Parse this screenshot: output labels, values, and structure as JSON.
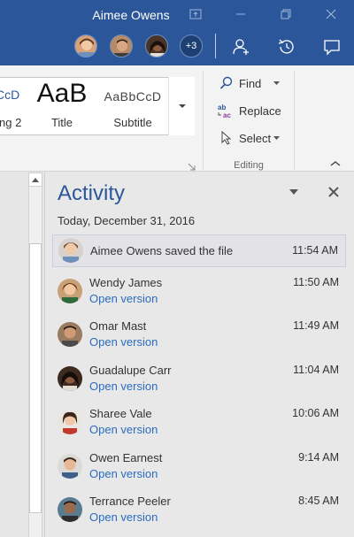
{
  "window": {
    "title": "Aimee Owens",
    "extra_collaborators": "+3"
  },
  "ribbon": {
    "styles": [
      {
        "sample": "CcD",
        "name": "ng 2"
      },
      {
        "sample": "AaB",
        "name": "Title"
      },
      {
        "sample": "AaBbCcD",
        "name": "Subtitle"
      }
    ],
    "editing": {
      "find_label": "Find",
      "replace_label": "Replace",
      "select_label": "Select",
      "group_label": "Editing"
    }
  },
  "activity": {
    "title": "Activity",
    "date": "Today, December 31, 2016",
    "items": [
      {
        "text": "Aimee Owens saved the file",
        "time": "11:54 AM",
        "link": ""
      },
      {
        "text": "Wendy James",
        "time": "11:50 AM",
        "link": "Open version"
      },
      {
        "text": "Omar Mast",
        "time": "11:49 AM",
        "link": "Open version"
      },
      {
        "text": "Guadalupe Carr",
        "time": "11:04 AM",
        "link": "Open version"
      },
      {
        "text": "Sharee Vale",
        "time": "10:06 AM",
        "link": "Open version"
      },
      {
        "text": "Owen Earnest",
        "time": "9:14 AM",
        "link": "Open version"
      },
      {
        "text": "Terrance Peeler",
        "time": "8:45 AM",
        "link": "Open version"
      }
    ]
  },
  "colors": {
    "titlebar": "#2b579a",
    "link": "#2b6cbd",
    "pane_background": "#e8e8e8"
  }
}
